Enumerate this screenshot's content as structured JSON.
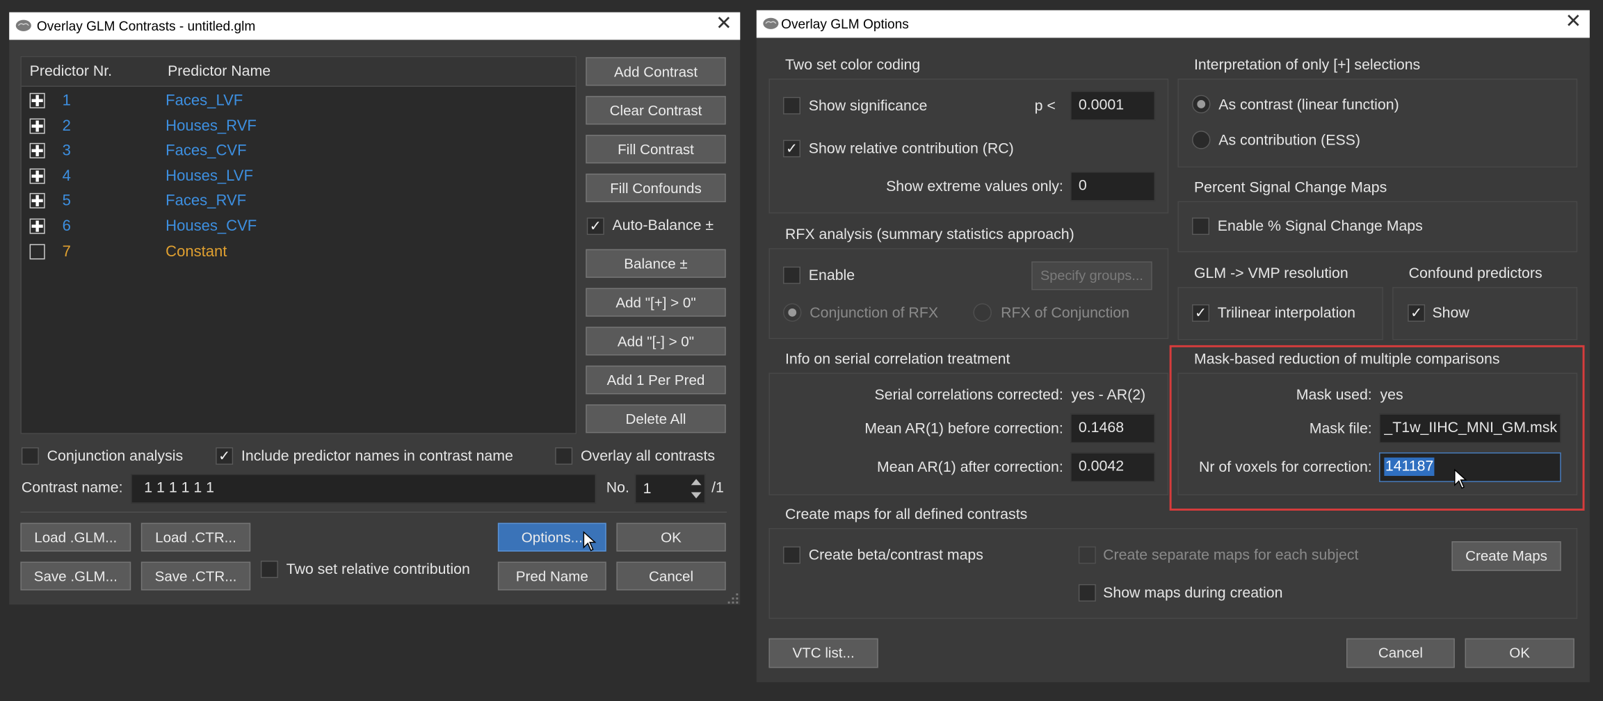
{
  "colors": {
    "accent_blue": "#3d8fe0",
    "orange": "#e0a030",
    "highlight_red": "#d63c3c",
    "selection": "#2f6fc0",
    "window_bg": "#3c3c3c"
  },
  "left": {
    "title": "Overlay GLM Contrasts - untitled.glm",
    "table": {
      "headers": [
        "Predictor Nr.",
        "Predictor Name"
      ],
      "rows": [
        {
          "nr": "1",
          "name": "Faces_LVF",
          "state": "plus",
          "color": "#3d8fe0"
        },
        {
          "nr": "2",
          "name": "Houses_RVF",
          "state": "plus",
          "color": "#3d8fe0"
        },
        {
          "nr": "3",
          "name": "Faces_CVF",
          "state": "plus",
          "color": "#3d8fe0"
        },
        {
          "nr": "4",
          "name": "Houses_LVF",
          "state": "plus",
          "color": "#3d8fe0"
        },
        {
          "nr": "5",
          "name": "Faces_RVF",
          "state": "plus",
          "color": "#3d8fe0"
        },
        {
          "nr": "6",
          "name": "Houses_CVF",
          "state": "plus",
          "color": "#3d8fe0"
        },
        {
          "nr": "7",
          "name": "Constant",
          "state": "empty",
          "color": "#e0a030"
        }
      ]
    },
    "buttons": {
      "add_contrast": "Add Contrast",
      "clear_contrast": "Clear Contrast",
      "fill_contrast": "Fill Contrast",
      "fill_confounds": "Fill Confounds",
      "balance": "Balance ±",
      "add_plus": "Add \"[+] > 0\"",
      "add_minus": "Add \"[-]  > 0\"",
      "add_per_pred": "Add 1 Per Pred",
      "delete_all": "Delete All",
      "load_glm": "Load .GLM...",
      "load_ctr": "Load .CTR...",
      "save_glm": "Save .GLM...",
      "save_ctr": "Save .CTR...",
      "options": "Options...",
      "ok": "OK",
      "pred_name": "Pred  Name",
      "cancel": "Cancel"
    },
    "auto_balance": {
      "label": "Auto-Balance ±",
      "checked": true
    },
    "conjunction": {
      "label": "Conjunction analysis",
      "checked": false
    },
    "include_names": {
      "label": "Include predictor names in contrast name",
      "checked": true
    },
    "overlay_all": {
      "label": "Overlay all contrasts",
      "checked": false
    },
    "contrast_name_label": "Contrast name:",
    "contrast_name_value": "1  1  1  1  1  1",
    "no_label": "No.",
    "no_value": "1",
    "no_total": "/1",
    "two_set_rc": {
      "label": "Two set relative contribution",
      "checked": false
    }
  },
  "right": {
    "title": "Overlay GLM Options",
    "two_set": {
      "heading": "Two set color coding",
      "show_significance": "Show significance",
      "p_label": "p <",
      "p_value": "0.0001",
      "show_rc": "Show relative contribution (RC)",
      "extreme_label": "Show extreme values only:",
      "extreme_value": "0"
    },
    "interpretation": {
      "heading": "Interpretation of only [+] selections",
      "as_contrast": "As contrast (linear function)",
      "as_contribution": "As contribution (ESS)"
    },
    "psc": {
      "heading": "Percent Signal Change Maps",
      "enable": "Enable % Signal Change Maps"
    },
    "rfx": {
      "heading": "RFX analysis (summary statistics approach)",
      "enable": "Enable",
      "specify": "Specify groups...",
      "conj_rfx": "Conjunction of RFX",
      "rfx_conj": "RFX of Conjunction"
    },
    "vmp": {
      "heading": "GLM -> VMP resolution",
      "trilinear": "Trilinear interpolation"
    },
    "confound": {
      "heading": "Confound predictors",
      "show": "Show"
    },
    "serial": {
      "heading": "Info on serial correlation treatment",
      "corrected_label": "Serial correlations corrected:",
      "corrected_value": "yes - AR(2)",
      "before_label": "Mean AR(1) before correction:",
      "before_value": "0.1468",
      "after_label": "Mean AR(1) after correction:",
      "after_value": "0.0042"
    },
    "mask": {
      "heading": "Mask-based reduction of multiple comparisons",
      "used_label": "Mask used:",
      "used_value": "yes",
      "file_label": "Mask file:",
      "file_value": "_T1w_IIHC_MNI_GM.msk",
      "voxels_label": "Nr of voxels for correction:",
      "voxels_value": "141187"
    },
    "maps": {
      "heading": "Create maps for all defined contrasts",
      "beta": "Create beta/contrast maps",
      "separate": "Create separate maps for each subject",
      "show_during": "Show maps during creation",
      "create": "Create Maps"
    },
    "buttons": {
      "vtc_list": "VTC list...",
      "cancel": "Cancel",
      "ok": "OK"
    }
  }
}
